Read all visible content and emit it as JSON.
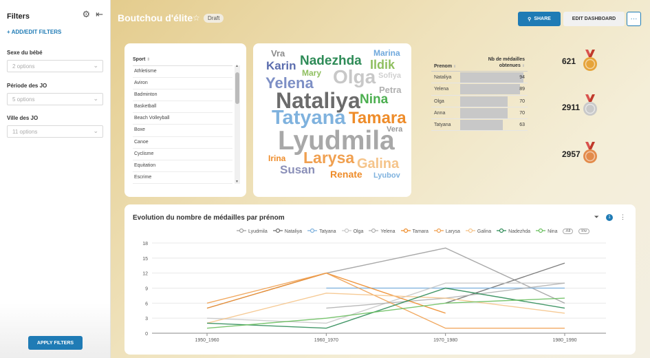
{
  "sidebar": {
    "title": "Filters",
    "add_filters": "ADD/EDIT FILTERS",
    "filters": [
      {
        "label": "Sexe du bébé",
        "placeholder": "2 options"
      },
      {
        "label": "Période des JO",
        "placeholder": "5 options"
      },
      {
        "label": "Ville des JO",
        "placeholder": "11 options"
      }
    ],
    "apply_label": "APPLY FILTERS"
  },
  "header": {
    "title": "Boutchou d'élite",
    "draft": "Draft",
    "share": "SHARE",
    "edit": "EDIT DASHBOARD",
    "more": "···"
  },
  "sport_list": {
    "header": "Sport",
    "items": [
      "Athletisme",
      "Aviron",
      "Badminton",
      "Basketball",
      "Beach Volleyball",
      "Boxe",
      "Canoe",
      "Cyclisme",
      "Equitation",
      "Escrime"
    ]
  },
  "word_cloud": {
    "words": [
      {
        "text": "Vra",
        "color": "#8c8c8c"
      },
      {
        "text": "Nadezhda",
        "color": "#2e8b57"
      },
      {
        "text": "Marina",
        "color": "#6fa8dc"
      },
      {
        "text": "Karin",
        "color": "#5b6dae"
      },
      {
        "text": "Mary",
        "color": "#8fbf5f"
      },
      {
        "text": "Ildik",
        "color": "#8fbf5f"
      },
      {
        "text": "Yelena",
        "color": "#7d8fc5"
      },
      {
        "text": "Olga",
        "color": "#c8c8c8"
      },
      {
        "text": "Sofiya",
        "color": "#d0d0d0"
      },
      {
        "text": "Petra",
        "color": "#b0b0b0"
      },
      {
        "text": "Nataliya",
        "color": "#6b6b6b"
      },
      {
        "text": "Nina",
        "color": "#4caf50"
      },
      {
        "text": "Tatyana",
        "color": "#7fb2de"
      },
      {
        "text": "Tamara",
        "color": "#ee8c2a"
      },
      {
        "text": "Vera",
        "color": "#999999"
      },
      {
        "text": "Lyudmila",
        "color": "#a8a8a8"
      },
      {
        "text": "Irina",
        "color": "#ee8c2a"
      },
      {
        "text": "Larysa",
        "color": "#f0a050"
      },
      {
        "text": "Galina",
        "color": "#f5c48a"
      },
      {
        "text": "Susan",
        "color": "#8a8fb8"
      },
      {
        "text": "Renate",
        "color": "#ee8c2a"
      },
      {
        "text": "Lyubov",
        "color": "#7fb2de"
      }
    ]
  },
  "medal_table": {
    "col_name": "Prenom",
    "col_value_line1": "Nb de médailles",
    "col_value_line2": "obtenues",
    "rows": [
      {
        "name": "Nataliya",
        "value": "94",
        "num": 94
      },
      {
        "name": "Yelena",
        "value": "89",
        "num": 89
      },
      {
        "name": "Olga",
        "value": "70",
        "num": 70
      },
      {
        "name": "Anna",
        "value": "70",
        "num": 70
      },
      {
        "name": "Tatyana",
        "value": "63",
        "num": 63
      }
    ]
  },
  "medals": [
    {
      "count": "621",
      "color": "#e6a43a",
      "ribbon": "#d9534f"
    },
    {
      "count": "2911",
      "color": "#c9c9c9",
      "ribbon": "#d9534f"
    },
    {
      "count": "2957",
      "color": "#e38b4a",
      "ribbon": "#d9534f"
    }
  ],
  "line_chart_card": {
    "title": "Evolution du nombre de médailles par prénom",
    "filter_count": "1",
    "legend_all": "All",
    "legend_inv": "Inv"
  },
  "chart_data": {
    "type": "line",
    "x": [
      "1950_1960",
      "1960_1970",
      "1970_1980",
      "1980_1990"
    ],
    "ylim": [
      0,
      18
    ],
    "yticks": [
      0,
      3,
      6,
      9,
      12,
      15,
      18
    ],
    "grid": true,
    "legend_position": "top",
    "series": [
      {
        "name": "Lyudmila",
        "color": "#a0a0a0",
        "values": [
          5,
          12,
          17,
          6
        ]
      },
      {
        "name": "Nataliya",
        "color": "#707070",
        "values": [
          null,
          null,
          6,
          14
        ]
      },
      {
        "name": "Tatyana",
        "color": "#7fb2de",
        "values": [
          null,
          9,
          9,
          9
        ]
      },
      {
        "name": "Olga",
        "color": "#c8c8c8",
        "values": [
          3,
          2,
          10,
          10
        ]
      },
      {
        "name": "Yelena",
        "color": "#b0b0b0",
        "values": [
          null,
          5,
          7,
          10
        ]
      },
      {
        "name": "Tamara",
        "color": "#ee8c2a",
        "values": [
          5,
          12,
          4,
          null
        ]
      },
      {
        "name": "Larysa",
        "color": "#f0a050",
        "values": [
          6,
          12,
          1,
          1
        ]
      },
      {
        "name": "Galina",
        "color": "#f5c48a",
        "values": [
          2,
          8,
          7,
          4
        ]
      },
      {
        "name": "Nadezhda",
        "color": "#2e8b57",
        "values": [
          2,
          1,
          9,
          5
        ]
      },
      {
        "name": "Nina",
        "color": "#6abf5f",
        "values": [
          1,
          3,
          6,
          7
        ]
      }
    ]
  }
}
